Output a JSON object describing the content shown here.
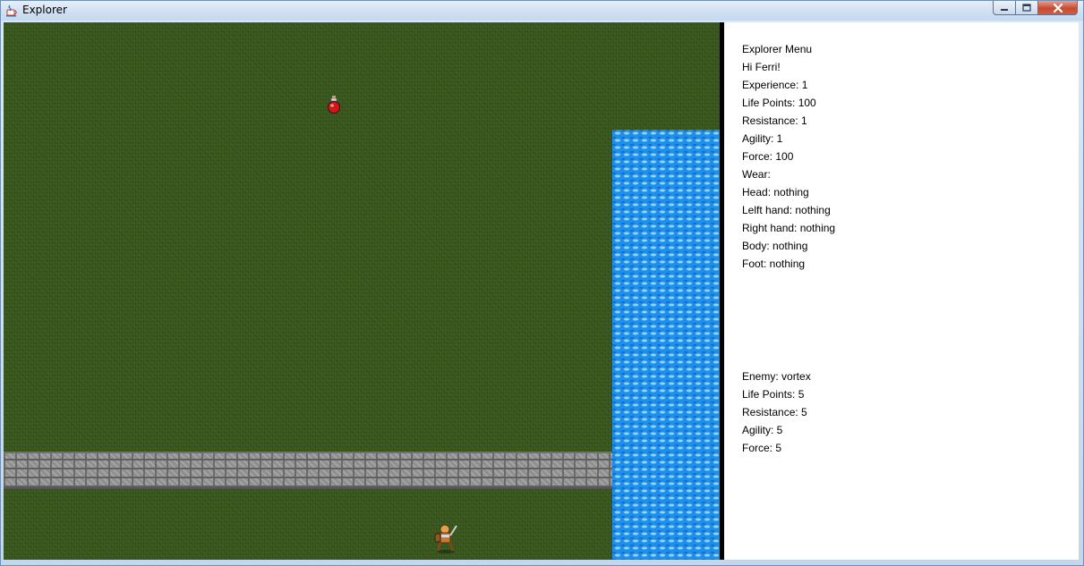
{
  "window": {
    "title": "Explorer",
    "icons": {
      "app": "java-cup-icon",
      "minimize": "minimize-icon",
      "maximize": "maximize-icon",
      "close": "close-icon"
    }
  },
  "map": {
    "tiles": [
      "grass",
      "water",
      "stone-wall"
    ],
    "items": [
      "red-potion"
    ],
    "player_sprite": "warrior"
  },
  "menu": {
    "title": "Explorer Menu",
    "greeting": "Hi Ferri!",
    "experience": "Experience: 1",
    "life_points": "Life Points: 100",
    "resistance": "Resistance: 1",
    "agility": "Agility: 1",
    "force": "Force: 100",
    "wear": "Wear:",
    "head": "Head: nothing",
    "left_hand": "Lelft hand: nothing",
    "right_hand": "Right hand: nothing",
    "body": "Body: nothing",
    "foot": "Foot: nothing"
  },
  "enemy": {
    "name": "Enemy: vortex",
    "life_points": "Life Points: 5",
    "resistance": "Resistance: 5",
    "agility": "Agility: 5",
    "force": "Force: 5"
  },
  "colors": {
    "grass": "#3a5a1f",
    "water": "#1e8fe8",
    "wall": "#8f8f8f",
    "panel": "#ffffff"
  }
}
